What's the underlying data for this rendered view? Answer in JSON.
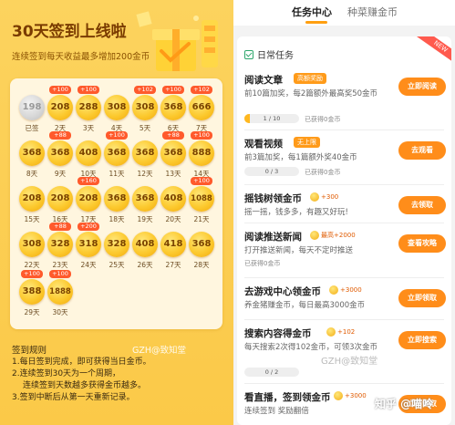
{
  "left": {
    "title": "30天签到上线啦",
    "subtitle": "连续签到每天收益最多增加200金币",
    "days": [
      {
        "value": "198",
        "label": "已签",
        "done": true,
        "bonus": ""
      },
      {
        "value": "208",
        "label": "2天",
        "done": false,
        "bonus": "+100"
      },
      {
        "value": "288",
        "label": "3天",
        "done": false,
        "bonus": "+100"
      },
      {
        "value": "308",
        "label": "4天",
        "done": false,
        "bonus": ""
      },
      {
        "value": "308",
        "label": "5天",
        "done": false,
        "bonus": "+102"
      },
      {
        "value": "368",
        "label": "6天",
        "done": false,
        "bonus": "+100"
      },
      {
        "value": "666",
        "label": "7天",
        "done": false,
        "bonus": "+102"
      },
      {
        "value": "368",
        "label": "8天",
        "done": false,
        "bonus": ""
      },
      {
        "value": "368",
        "label": "9天",
        "done": false,
        "bonus": "+88"
      },
      {
        "value": "408",
        "label": "10天",
        "done": false,
        "bonus": ""
      },
      {
        "value": "368",
        "label": "11天",
        "done": false,
        "bonus": "+100"
      },
      {
        "value": "368",
        "label": "12天",
        "done": false,
        "bonus": ""
      },
      {
        "value": "368",
        "label": "13天",
        "done": false,
        "bonus": "+88"
      },
      {
        "value": "888",
        "label": "14天",
        "done": false,
        "bonus": "+100"
      },
      {
        "value": "208",
        "label": "15天",
        "done": false,
        "bonus": ""
      },
      {
        "value": "208",
        "label": "16天",
        "done": false,
        "bonus": ""
      },
      {
        "value": "208",
        "label": "17天",
        "done": false,
        "bonus": "+160"
      },
      {
        "value": "368",
        "label": "18天",
        "done": false,
        "bonus": ""
      },
      {
        "value": "368",
        "label": "19天",
        "done": false,
        "bonus": ""
      },
      {
        "value": "408",
        "label": "20天",
        "done": false,
        "bonus": ""
      },
      {
        "value": "1088",
        "label": "21天",
        "done": false,
        "bonus": "+100"
      },
      {
        "value": "308",
        "label": "22天",
        "done": false,
        "bonus": ""
      },
      {
        "value": "328",
        "label": "23天",
        "done": false,
        "bonus": "+88"
      },
      {
        "value": "318",
        "label": "24天",
        "done": false,
        "bonus": "+200"
      },
      {
        "value": "328",
        "label": "25天",
        "done": false,
        "bonus": ""
      },
      {
        "value": "408",
        "label": "26天",
        "done": false,
        "bonus": ""
      },
      {
        "value": "418",
        "label": "27天",
        "done": false,
        "bonus": ""
      },
      {
        "value": "368",
        "label": "28天",
        "done": false,
        "bonus": ""
      },
      {
        "value": "388",
        "label": "29天",
        "done": false,
        "bonus": "+100"
      },
      {
        "value": "1888",
        "label": "30天",
        "done": false,
        "bonus": "+100"
      }
    ],
    "rules_title": "签到规则",
    "rules": [
      "1.每日签到完成，即可获得当日金币。",
      "2.连续签到30天为一个周期，",
      "连续签到天数越多获得金币越多。",
      "3.签到中断后从第一天重新记录。"
    ],
    "watermark": "GZH@致知堂"
  },
  "right": {
    "tab_active": "任务中心",
    "tab_inactive": "种菜赚金币",
    "section": "日常任务",
    "ribbon": "NEW",
    "tasks": [
      {
        "title": "阅读文章",
        "pill": "高额奖励",
        "pill_type": "orange",
        "desc": "前10篇加奖，每2篇额外最高奖50金币",
        "progress_text": "1 / 10",
        "progress": 0.1,
        "got": "已获得0金币",
        "btn": "立即阅读"
      },
      {
        "title": "观看视频",
        "pill": "无上限",
        "pill_type": "orange",
        "desc": "前3篇加奖，每1篇额外奖40金币",
        "progress_text": "0 / 3",
        "progress": 0,
        "got": "已获得0金币",
        "btn": "去观看"
      },
      {
        "title": "摇钱树领金币",
        "pill": "+300",
        "pill_type": "coin",
        "desc": "摇一摇，钱多多，有趣又好玩!",
        "btn": "去领取"
      },
      {
        "title": "阅读推送新闻",
        "pill": "最高+2000",
        "pill_type": "coin",
        "desc": "打开推送新闻，每天不定时推送",
        "got": "已获得0金币",
        "btn": "查看攻略"
      },
      {
        "title": "去游戏中心领金币",
        "pill": "+3000",
        "pill_type": "coin",
        "desc": "养金猪赚金币，每日最高3000金币",
        "btn": "立即领取"
      },
      {
        "title": "搜索内容得金币",
        "pill": "+102",
        "pill_type": "coin",
        "desc": "每天搜索2次得102金币，可领3次金币",
        "progress_text": "0 / 2",
        "progress": 0,
        "btn": "立即搜索"
      },
      {
        "title": "看直播，签到领金币",
        "pill": "+3000",
        "pill_type": "coin",
        "desc": "连续签到  奖励翻倍",
        "btn": "立即领取"
      }
    ],
    "watermark": "GZH@致知堂",
    "zhihu": "知乎 @喵呤"
  },
  "colors": {
    "accent": "#ff8d1a",
    "panel": "#fbc948",
    "badge": "#ff5a2c",
    "done_coin": "#d6d6d6"
  }
}
